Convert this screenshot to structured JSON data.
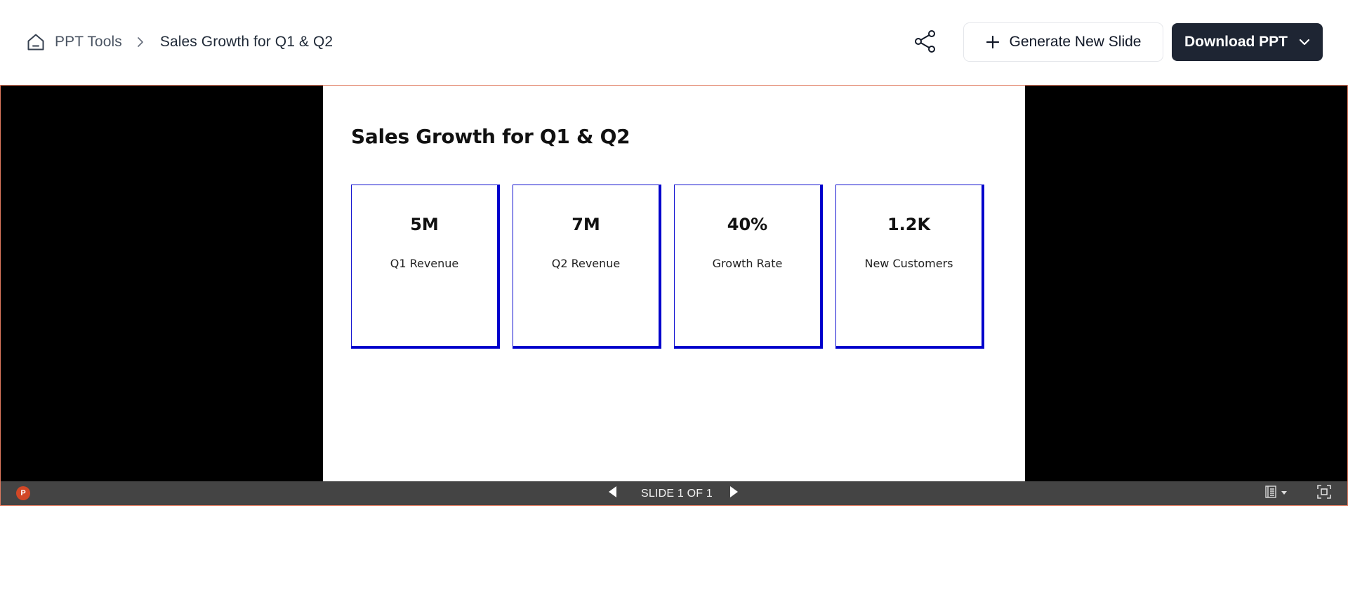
{
  "breadcrumb": {
    "home_icon": "home-icon",
    "root_label": "PPT Tools",
    "separator_icon": "chevron-right-icon",
    "current": "Sales Growth for Q1 & Q2"
  },
  "toolbar": {
    "share_icon": "share-icon",
    "generate_label": "Generate New Slide",
    "download_label": "Download PPT"
  },
  "slide": {
    "title": "Sales Growth for Q1 & Q2",
    "cards": [
      {
        "value": "5M",
        "label": "Q1 Revenue"
      },
      {
        "value": "7M",
        "label": "Q2 Revenue"
      },
      {
        "value": "40%",
        "label": "Growth Rate"
      },
      {
        "value": "1.2K",
        "label": "New Customers"
      }
    ]
  },
  "viewer": {
    "slide_counter": "SLIDE 1 OF 1"
  },
  "colors": {
    "accent_dark": "#1e2533",
    "card_border": "#0000cc",
    "viewer_bg": "#000000",
    "statusbar_bg": "#444444",
    "ppt_logo": "#d24726"
  }
}
